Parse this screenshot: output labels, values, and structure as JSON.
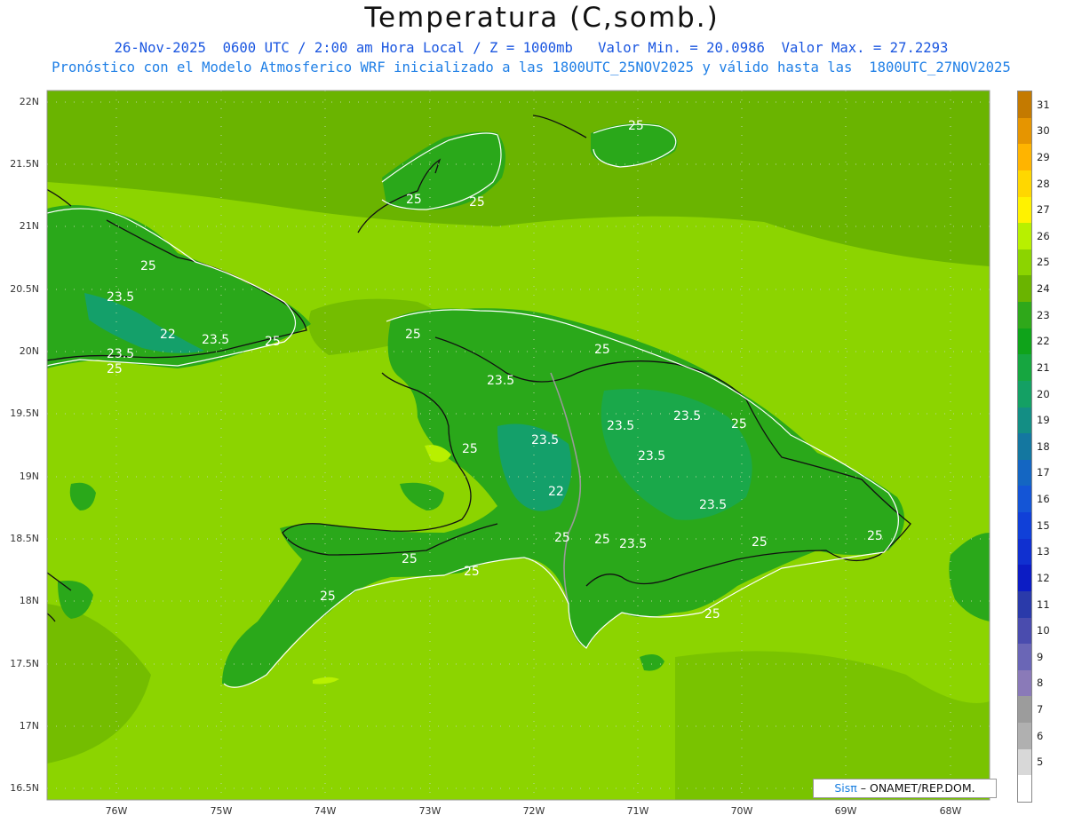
{
  "header": {
    "title": "Temperatura (C,somb.)",
    "line1": "26-Nov-2025  0600 UTC / 2:00 am Hora Local / Z = 1000mb   Valor Min. = 20.0986  Valor Max. = 27.2293",
    "line2": "Pronóstico con el Modelo Atmosferico WRF inicializado a las 1800UTC_25NOV2025 y válido hasta las  1800UTC_27NOV2025"
  },
  "axes": {
    "y_labels": [
      "22N",
      "21.5N",
      "21N",
      "20.5N",
      "20N",
      "19.5N",
      "19N",
      "18.5N",
      "18N",
      "17.5N",
      "17N",
      "16.5N"
    ],
    "x_labels": [
      "76W",
      "75W",
      "74W",
      "73W",
      "72W",
      "71W",
      "70W",
      "69W",
      "68W"
    ]
  },
  "contour_labels": [
    "25",
    "25",
    "25",
    "25",
    "23.5",
    "22",
    "23.5",
    "25",
    "23.5",
    "25",
    "25",
    "23.5",
    "23.5",
    "25",
    "23.5",
    "25",
    "23.5",
    "25",
    "22",
    "23.5",
    "23.5",
    "23.5",
    "25",
    "25",
    "25",
    "25",
    "25",
    "25",
    "25",
    "25"
  ],
  "colorbar": {
    "labels": [
      "31",
      "30",
      "29",
      "28",
      "27",
      "26",
      "25",
      "24",
      "23",
      "22",
      "21",
      "20",
      "19",
      "18",
      "17",
      "16",
      "15",
      "13",
      "12",
      "11",
      "10",
      "9",
      "8",
      "7",
      "6",
      "5"
    ],
    "colors": [
      "#c47a00",
      "#e69500",
      "#ffb400",
      "#ffd700",
      "#fff200",
      "#b8f000",
      "#8cd400",
      "#6ab400",
      "#2fa81a",
      "#0fa31a",
      "#16a640",
      "#14a064",
      "#138e84",
      "#1477a0",
      "#1466c2",
      "#1455d6",
      "#1040d8",
      "#1030d0",
      "#0c1cc4",
      "#2a3aaa",
      "#4a4cae",
      "#6a66b6",
      "#8a7ab8",
      "#9c9c9c",
      "#b0b0b0",
      "#d8d8d8",
      "#ffffff"
    ]
  },
  "credit": {
    "brand": "Sisπ",
    "text": " – ONAMET/REP.DOM."
  },
  "field_colors": {
    "ocean": "#8cd400",
    "warm_sea": "#6ab400",
    "land": "#22a81a",
    "cool_land": "#14a06a",
    "coast": "#111111",
    "border": "#9a9a9a",
    "contour": "#ffffff"
  }
}
